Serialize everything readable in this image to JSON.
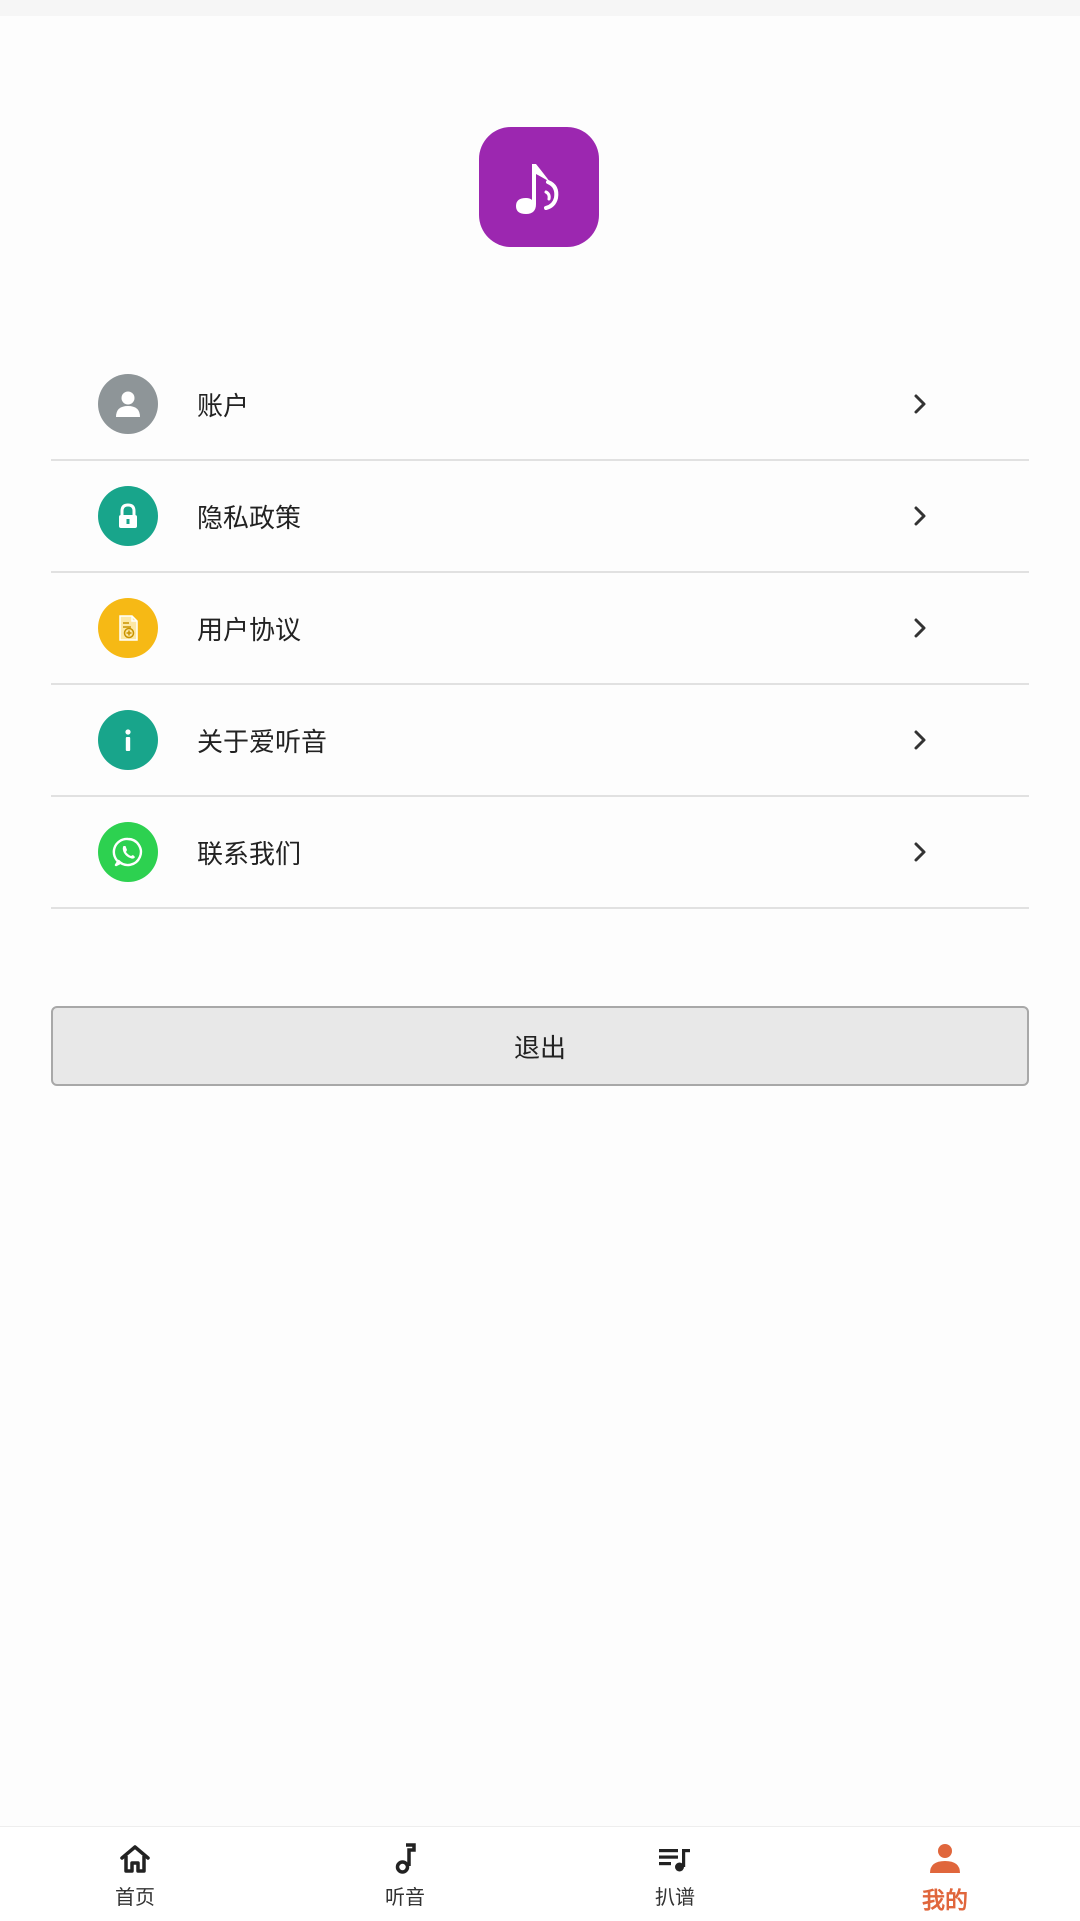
{
  "app": {
    "logo_icon": "music-note-ear-icon",
    "logo_color": "#9c27b0"
  },
  "menu": {
    "items": [
      {
        "label": "账户",
        "icon": "user-icon",
        "icon_color": "#8e9598"
      },
      {
        "label": "隐私政策",
        "icon": "lock-icon",
        "icon_color": "#18a58b"
      },
      {
        "label": "用户协议",
        "icon": "document-icon",
        "icon_color": "#f6b915"
      },
      {
        "label": "关于爱听音",
        "icon": "info-icon",
        "icon_color": "#18a58b"
      },
      {
        "label": "联系我们",
        "icon": "whatsapp-icon",
        "icon_color": "#2dd150"
      }
    ]
  },
  "logout": {
    "label": "退出"
  },
  "bottom_nav": {
    "tabs": [
      {
        "label": "首页",
        "icon": "home-icon"
      },
      {
        "label": "听音",
        "icon": "music-note-icon"
      },
      {
        "label": "扒谱",
        "icon": "playlist-music-icon"
      },
      {
        "label": "我的",
        "icon": "person-icon"
      }
    ],
    "active_color": "#e0663c"
  }
}
